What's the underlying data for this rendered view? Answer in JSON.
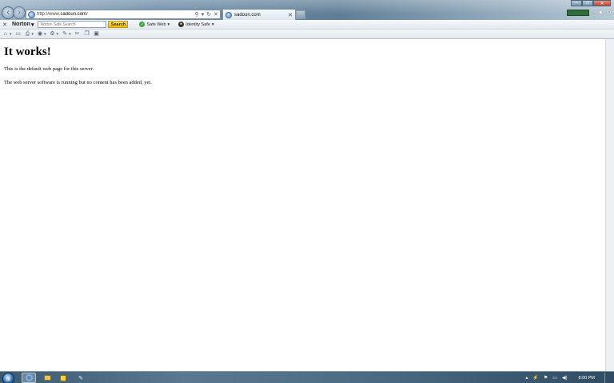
{
  "browser": {
    "address_url_prefix": "http://www.",
    "address_url_host": "sadoun.com",
    "address_url_suffix": "/",
    "tab_title": "sadoun.com"
  },
  "norton_toolbar": {
    "brand": "Norton",
    "search_placeholder": "Norton Safe Search",
    "search_button": "Search",
    "safe_web_label": "Safe Web",
    "identity_safe_label": "Identity Safe"
  },
  "page": {
    "heading": "It works!",
    "paragraph_1": "This is the default web page for this server.",
    "paragraph_2": "The web server software is running but no content has been added, yet."
  },
  "taskbar": {
    "clock": "8:00 PM"
  },
  "colors": {
    "norton_search_button": "#f2b900",
    "safe_web_check": "#3aa53a",
    "close_button": "#c2432e"
  }
}
